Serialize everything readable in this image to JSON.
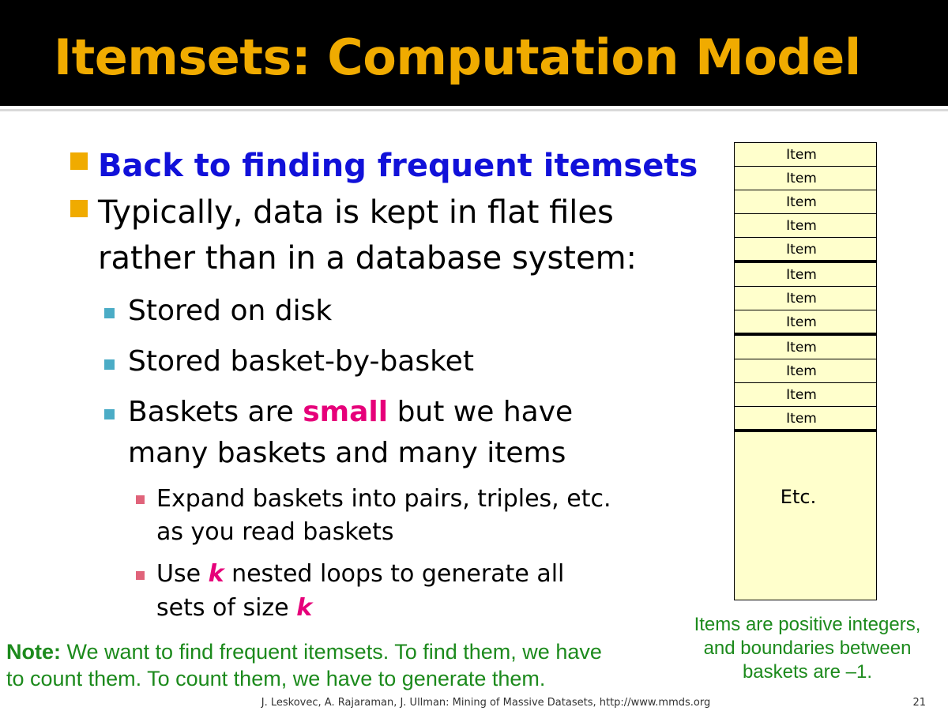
{
  "title": "Itemsets: Computation Model",
  "bullets": {
    "b1": "Back to finding frequent itemsets",
    "b2_line1": "Typically, data is kept in flat files",
    "b2_line2": "rather than in a database system:",
    "sub1": "Stored on disk",
    "sub2": "Stored basket-by-basket",
    "sub3_a": "Baskets are ",
    "sub3_highlight": "small",
    "sub3_b": " but we have",
    "sub3_line2": "many baskets and many items",
    "subsub1_line1": "Expand baskets into pairs, triples, etc.",
    "subsub1_line2": "as you read baskets",
    "subsub2_a": "Use ",
    "subsub2_k": "k",
    "subsub2_b": " nested loops to generate all",
    "subsub2_line2": "sets of size ",
    "subsub2_k2": "k"
  },
  "diagram": {
    "item_label": "Item",
    "etc_label": "Etc."
  },
  "note": {
    "label": "Note:",
    "line1": " We want to find frequent itemsets. To find them, we have",
    "line2": "to count them. To count them, we have to generate them."
  },
  "side_note": {
    "line1": "Items are positive integers,",
    "line2": "and boundaries between",
    "line3": "baskets are –1."
  },
  "footer": "J. Leskovec, A. Rajaraman, J. Ullman: Mining of Massive Datasets, http://www.mmds.org",
  "page_number": "21",
  "colors": {
    "title": "#f0ab00",
    "emphasis_blue": "#1111d9",
    "emphasis_pink": "#e6007a",
    "note_green": "#1c8a1c",
    "file_fill": "#ffffcc",
    "bullet_l1": "#f0ab00",
    "bullet_l2": "#4bacc6",
    "bullet_l3": "#e0637a"
  }
}
